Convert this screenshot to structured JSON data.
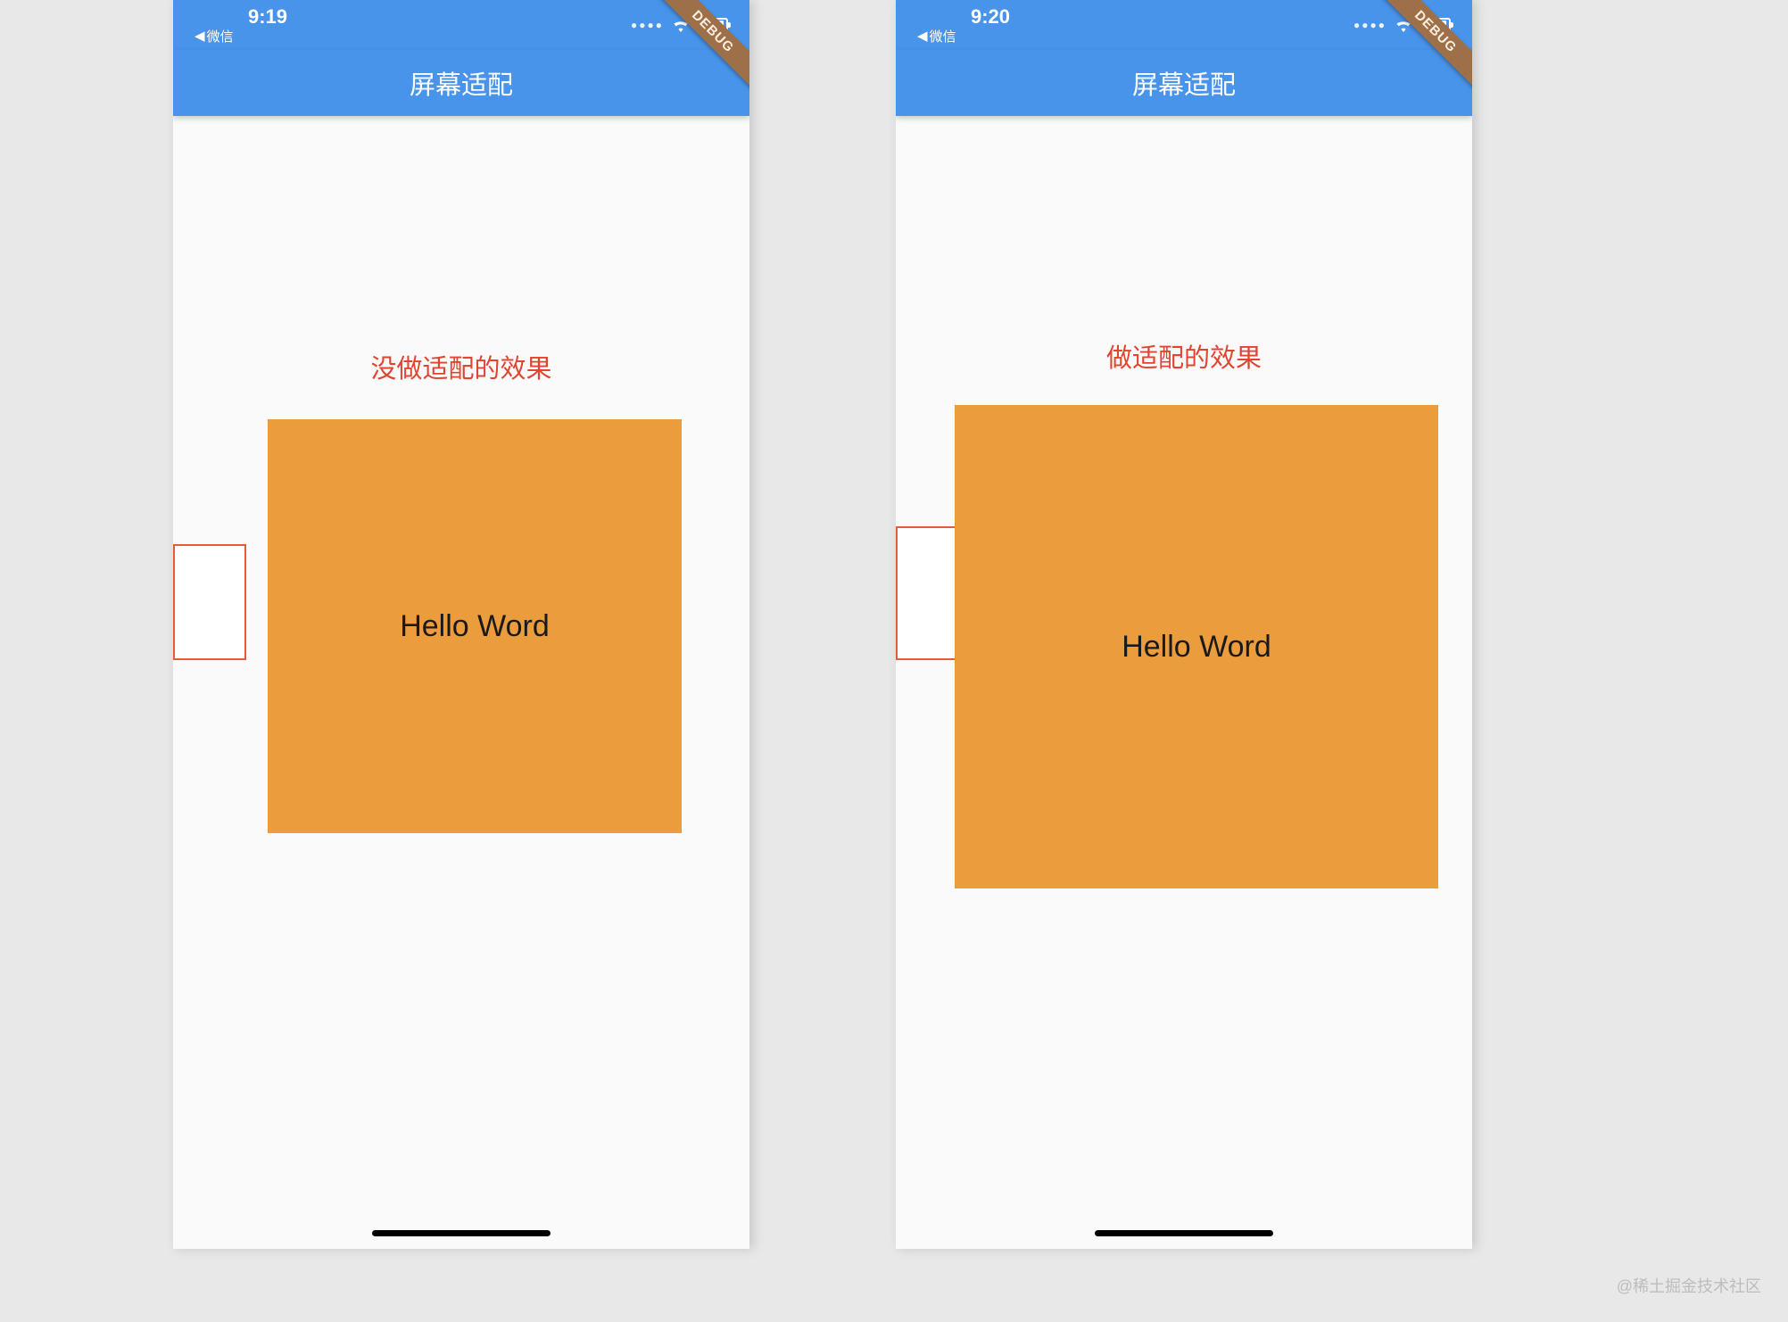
{
  "phones": [
    {
      "status": {
        "time": "9:19",
        "back_label": "微信"
      },
      "app_bar": {
        "title": "屏幕适配"
      },
      "debug_label": "DEBUG",
      "content": {
        "heading": "没做适配的效果",
        "box_text": "Hello Word"
      }
    },
    {
      "status": {
        "time": "9:20",
        "back_label": "微信"
      },
      "app_bar": {
        "title": "屏幕适配"
      },
      "debug_label": "DEBUG",
      "content": {
        "heading": "做适配的效果",
        "box_text": "Hello Word"
      }
    }
  ],
  "watermark": "@稀土掘金技术社区",
  "colors": {
    "app_bar": "#4894ea",
    "accent_orange": "#eb9c3c",
    "label_red": "#e24432"
  }
}
